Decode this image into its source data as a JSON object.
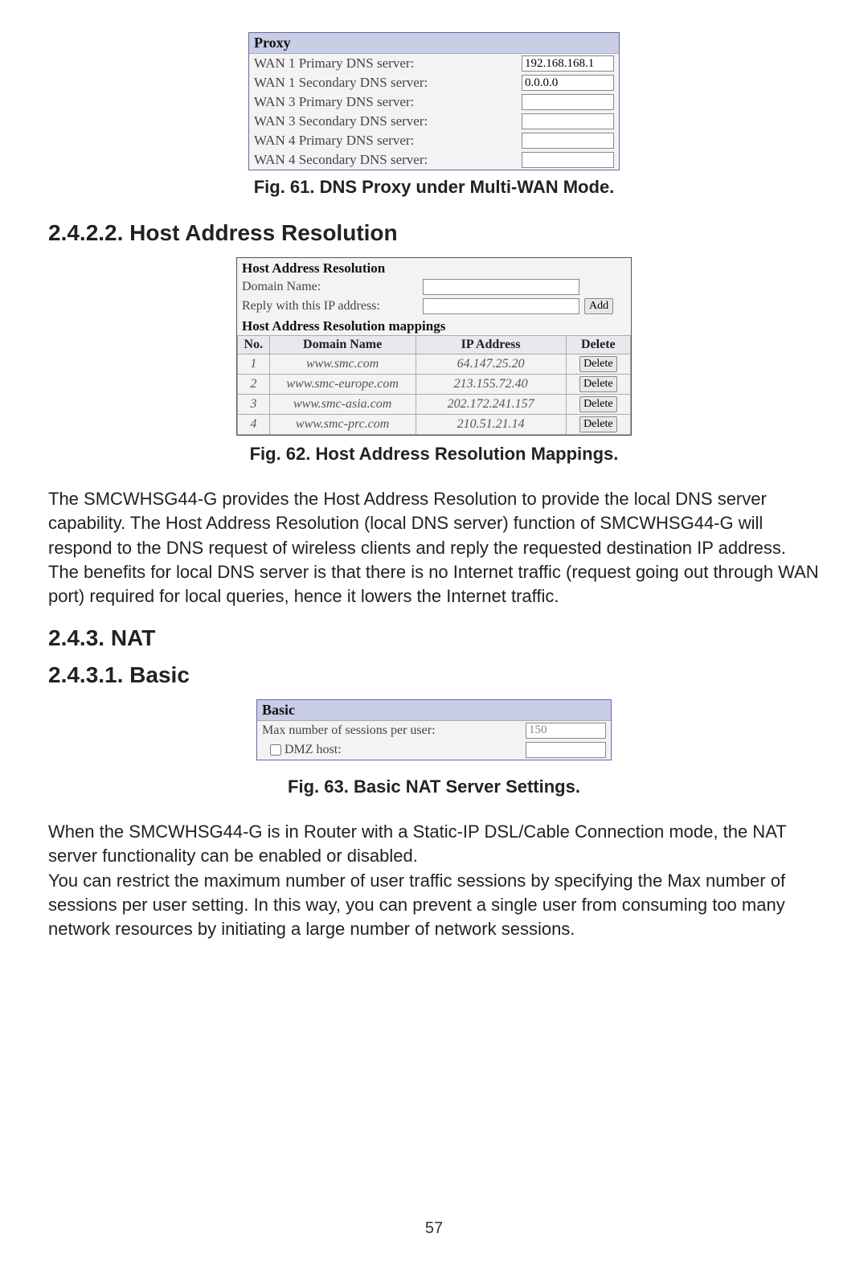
{
  "page_number": "57",
  "proxy_panel": {
    "title": "Proxy",
    "rows": [
      {
        "label": "WAN 1 Primary DNS server:",
        "value": "192.168.168.1"
      },
      {
        "label": "WAN 1 Secondary DNS server:",
        "value": "0.0.0.0"
      },
      {
        "label": "WAN 3 Primary DNS server:",
        "value": ""
      },
      {
        "label": "WAN 3 Secondary DNS server:",
        "value": ""
      },
      {
        "label": "WAN 4 Primary DNS server:",
        "value": ""
      },
      {
        "label": "WAN 4 Secondary DNS server:",
        "value": ""
      }
    ]
  },
  "fig61_caption": "Fig. 61. DNS Proxy under Multi-WAN Mode.",
  "section_24222_heading": "2.4.2.2. Host Address Resolution",
  "har_panel": {
    "title1": "Host Address Resolution",
    "domain_name_label": "Domain Name:",
    "domain_name_value": "",
    "reply_label": "Reply with this IP address:",
    "reply_value": "",
    "add_button": "Add",
    "title2": "Host Address Resolution mappings",
    "columns": {
      "no": "No.",
      "domain": "Domain Name",
      "ip": "IP Address",
      "delete": "Delete"
    },
    "rows": [
      {
        "no": "1",
        "domain": "www.smc.com",
        "ip": "64.147.25.20",
        "delete": "Delete"
      },
      {
        "no": "2",
        "domain": "www.smc-europe.com",
        "ip": "213.155.72.40",
        "delete": "Delete"
      },
      {
        "no": "3",
        "domain": "www.smc-asia.com",
        "ip": "202.172.241.157",
        "delete": "Delete"
      },
      {
        "no": "4",
        "domain": "www.smc-prc.com",
        "ip": "210.51.21.14",
        "delete": "Delete"
      }
    ]
  },
  "fig62_caption": "Fig. 62. Host Address Resolution Mappings.",
  "paragraph_har": "The SMCWHSG44-G provides the Host Address Resolution to provide the local DNS server capability. The Host Address Resolution (local DNS server) function of SMCWHSG44-G will respond to the DNS request of wireless clients and reply the requested destination IP address. The benefits for local DNS server is that there is no Internet traffic (request going out through WAN port) required for local queries, hence it lowers the Internet traffic.",
  "section_243_heading": "2.4.3. NAT",
  "section_2431_heading": "2.4.3.1. Basic",
  "basic_panel": {
    "title": "Basic",
    "max_sessions_label": "Max number of sessions per user:",
    "max_sessions_value": "150",
    "dmz_label": "DMZ host:",
    "dmz_checked": false,
    "dmz_value": ""
  },
  "fig63_caption": "Fig. 63. Basic NAT Server Settings.",
  "paragraph_nat": "When the SMCWHSG44-G is in Router with a Static-IP DSL/Cable Connection mode, the NAT server functionality can be enabled or disabled.\nYou can restrict the maximum number of user traffic sessions by specifying the Max number of sessions per user setting. In this way, you can prevent a single user from consuming too many network resources by initiating a large number of network sessions."
}
